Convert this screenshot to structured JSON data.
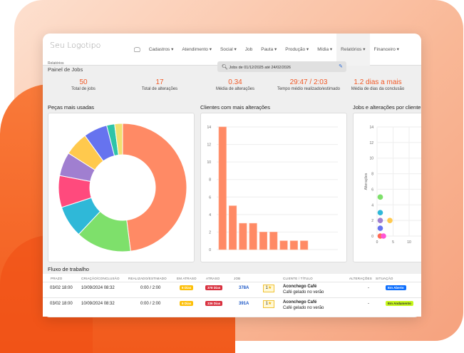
{
  "nav": {
    "logo": "Seu Logotipo",
    "items": [
      "Cadastros ▾",
      "Atendimento ▾",
      "Social ▾",
      "Job",
      "Pauta ▾",
      "Produção ▾",
      "Mídia ▾",
      "Relatórios ▾",
      "Financeiro ▾"
    ],
    "active": "Relatórios ▾"
  },
  "header": {
    "breadcrumb": "Relatórios",
    "title": "Painel de Jobs",
    "search": "Jobs de 01/12/2025 até 24/02/2026"
  },
  "kpis": [
    {
      "value": "50",
      "label": "Total de jobs"
    },
    {
      "value": "17",
      "label": "Total de alterações"
    },
    {
      "value": "0.34",
      "label": "Média de alterações"
    },
    {
      "value": "29:47 / 2:03",
      "label": "Tempo médio realizado/estimado"
    },
    {
      "value": "1.2 dias a mais",
      "label": "Média de dias da conclusão"
    }
  ],
  "sections": {
    "pie": "Peças mais usadas",
    "bar": "Clientes com mais alterações",
    "scatter": "Jobs e alterações por cliente",
    "flow": "Fluxo de trabalho"
  },
  "chart_data": [
    {
      "type": "pie",
      "donut": true,
      "values": [
        24,
        7,
        4,
        4,
        3,
        3,
        3,
        1,
        1
      ],
      "colors": [
        "#ff8a65",
        "#7ee06b",
        "#2fb8d8",
        "#ff4a7d",
        "#a07fd0",
        "#ffc94d",
        "#6673ef",
        "#2ec4a8",
        "#f0e070"
      ]
    },
    {
      "type": "bar",
      "values": [
        14,
        5,
        3,
        3,
        2,
        2,
        1,
        1,
        1
      ],
      "ylim": [
        0,
        14
      ],
      "yticks": [
        0,
        2,
        4,
        6,
        8,
        10,
        12,
        14
      ],
      "color": "#ff8a65",
      "grid": true
    },
    {
      "type": "scatter",
      "ylabel": "Alterações",
      "ylim": [
        0,
        14
      ],
      "yticks": [
        0,
        2,
        4,
        6,
        8,
        10,
        12,
        14
      ],
      "xticks": [
        0,
        5,
        10
      ],
      "grid": true,
      "points": [
        {
          "x": 1,
          "y": 5,
          "color": "#7ee06b"
        },
        {
          "x": 1,
          "y": 3,
          "color": "#2fb8d8"
        },
        {
          "x": 1,
          "y": 2,
          "color": "#a07fd0"
        },
        {
          "x": 4,
          "y": 2,
          "color": "#ffc94d"
        },
        {
          "x": 1,
          "y": 1,
          "color": "#6673ef"
        },
        {
          "x": 1,
          "y": 0,
          "color": "#ff6a55"
        },
        {
          "x": 2,
          "y": 0,
          "color": "#ff55d5"
        }
      ]
    }
  ],
  "table": {
    "headers": [
      "PRAZO",
      "CRIAÇÃO/CONCLUSÃO",
      "REALIZADO/ESTIMADO",
      "EM ATRASO",
      "ATRASO",
      "JOB",
      "CLIENTE / TÍTULO",
      "ALTERAÇÕES",
      "SITUAÇÃO"
    ],
    "rows": [
      {
        "prazo": "03/02 18:00",
        "criacao": "10/09/2024 08:32",
        "realizado": "0:00 / 2:00",
        "em_atraso": "6 Dias",
        "atraso": "378 Dias",
        "job": "378A",
        "rating": "1",
        "cliente": "Aconchego Café",
        "titulo": "Café gelado no verão",
        "alteracoes": "-",
        "situacao": "Em Aberto"
      },
      {
        "prazo": "03/02 18:00",
        "criacao": "10/09/2024 08:32",
        "realizado": "0:00 / 2:00",
        "em_atraso": "6 Dias",
        "atraso": "336 Dias",
        "job": "391A",
        "rating": "1",
        "cliente": "Aconchego Café",
        "titulo": "Café gelado no verão",
        "alteracoes": "-",
        "situacao": "Em Andamento"
      }
    ]
  }
}
